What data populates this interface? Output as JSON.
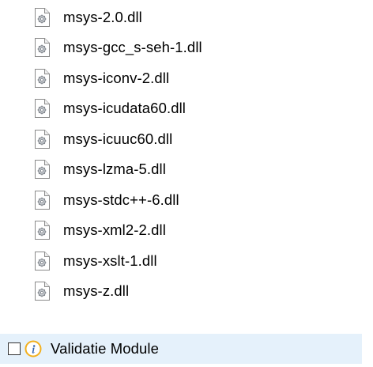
{
  "files": [
    {
      "name": "msys-2.0.dll",
      "icon": "dll-file-icon"
    },
    {
      "name": "msys-gcc_s-seh-1.dll",
      "icon": "dll-file-icon"
    },
    {
      "name": "msys-iconv-2.dll",
      "icon": "dll-file-icon"
    },
    {
      "name": "msys-icudata60.dll",
      "icon": "dll-file-icon"
    },
    {
      "name": "msys-icuuc60.dll",
      "icon": "dll-file-icon"
    },
    {
      "name": "msys-lzma-5.dll",
      "icon": "dll-file-icon"
    },
    {
      "name": "msys-stdc++-6.dll",
      "icon": "dll-file-icon"
    },
    {
      "name": "msys-xml2-2.dll",
      "icon": "dll-file-icon"
    },
    {
      "name": "msys-xslt-1.dll",
      "icon": "dll-file-icon"
    },
    {
      "name": "msys-z.dll",
      "icon": "dll-file-icon"
    }
  ],
  "module": {
    "label": "Validatie Module",
    "checked": false,
    "icon": "info-icon",
    "highlight_color": "#e5f1fb",
    "icon_color": "#f2b01e"
  }
}
